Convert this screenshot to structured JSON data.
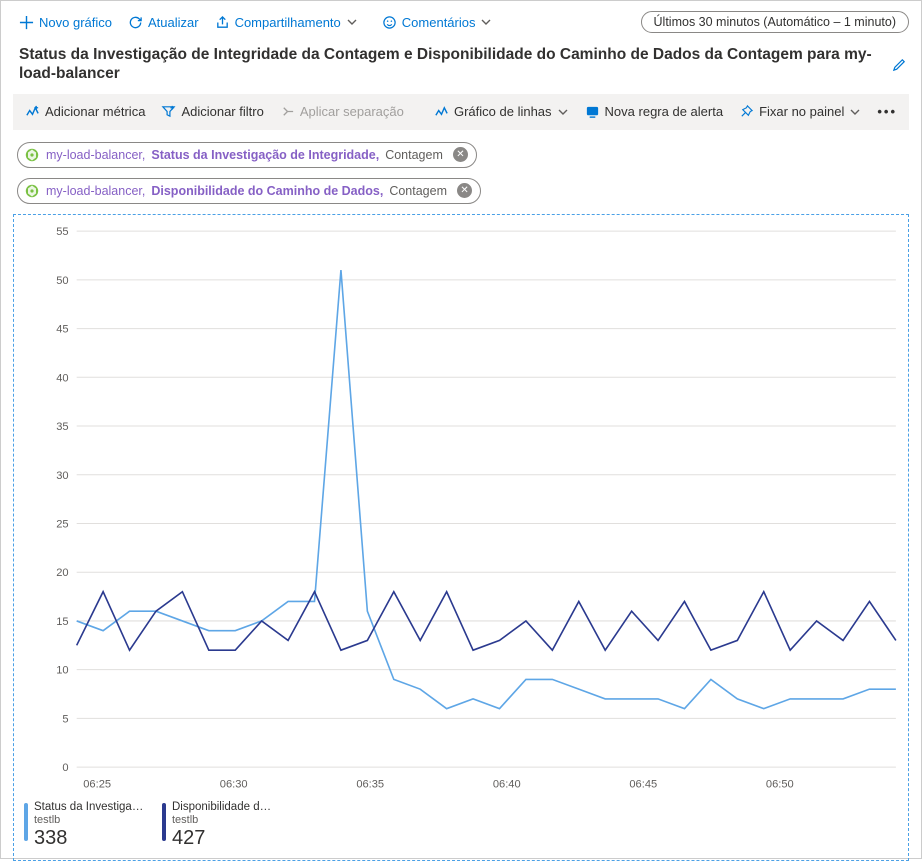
{
  "topbar": {
    "new_chart": "Novo gráfico",
    "refresh": "Atualizar",
    "share": "Compartilhamento",
    "comments": "Comentários",
    "time_range": "Últimos 30 minutos (Automático – 1 minuto)"
  },
  "title": "Status da Investigação de Integridade da Contagem e Disponibilidade do Caminho de Dados da Contagem para my-load-balancer",
  "toolbar": {
    "add_metric": "Adicionar métrica",
    "add_filter": "Adicionar filtro",
    "apply_split": "Aplicar separação",
    "chart_type": "Gráfico de linhas",
    "new_alert": "Nova regra de alerta",
    "pin": "Fixar no painel"
  },
  "pills": [
    {
      "resource": "my-load-balancer,",
      "metric": "Status da Investigação de Integridade,",
      "agg": "Contagem"
    },
    {
      "resource": "my-load-balancer,",
      "metric": "Disponibilidade do Caminho de Dados,",
      "agg": "Contagem"
    }
  ],
  "legend": [
    {
      "name": "Status da Investigaç…",
      "sub": "testlb",
      "value": "338",
      "color": "#5ea6e6"
    },
    {
      "name": "Disponibilidade d…",
      "sub": "testlb",
      "value": "427",
      "color": "#2b3a8f"
    }
  ],
  "chart_data": {
    "type": "line",
    "xlabel": "",
    "ylabel": "",
    "ylim": [
      0,
      55
    ],
    "x_tick_labels": [
      "06:25",
      "06:30",
      "06:35",
      "06:40",
      "06:45",
      "06:50"
    ],
    "x": [
      0,
      1,
      2,
      3,
      4,
      5,
      6,
      7,
      8,
      9,
      10,
      11,
      12,
      13,
      14,
      15,
      16,
      17,
      18,
      19,
      20,
      21,
      22,
      23,
      24,
      25,
      26,
      27,
      28,
      29
    ],
    "series": [
      {
        "name": "Status da Investigação de Integridade",
        "color": "#5ea6e6",
        "values": [
          15,
          14,
          16,
          16,
          15,
          14,
          14,
          15,
          17,
          17,
          51,
          16,
          9,
          8,
          6,
          7,
          6,
          9,
          9,
          8,
          7,
          7,
          7,
          6,
          9,
          7,
          6,
          7,
          7,
          7,
          8,
          8
        ]
      },
      {
        "name": "Disponibilidade do Caminho de Dados",
        "color": "#2b3a8f",
        "values": [
          12.5,
          18,
          12,
          16,
          18,
          12,
          12,
          15,
          13,
          18,
          12,
          13,
          18,
          13,
          18,
          12,
          13,
          15,
          12,
          17,
          12,
          16,
          13,
          17,
          12,
          13,
          18,
          12,
          15,
          13,
          17,
          13
        ]
      }
    ]
  }
}
